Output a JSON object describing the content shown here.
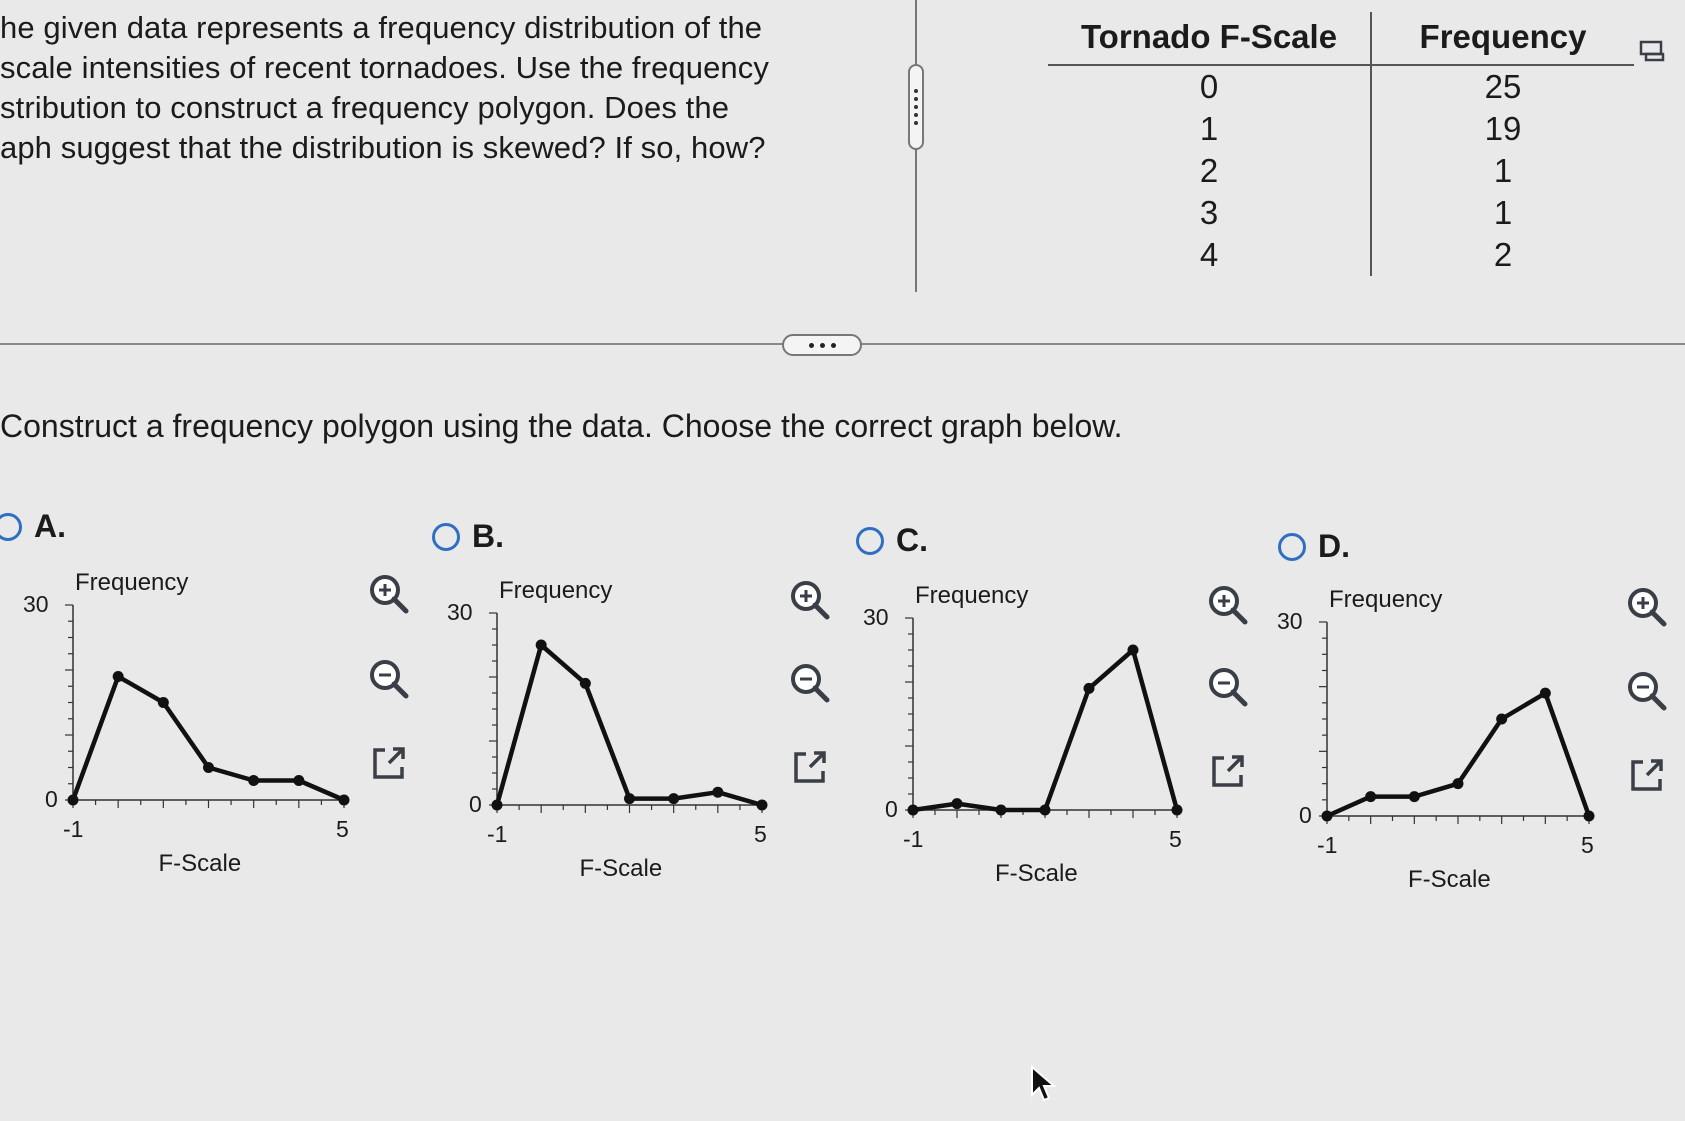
{
  "question": {
    "lines": [
      "he given data represents a frequency distribution of the",
      "scale intensities of recent tornadoes. Use the frequency",
      "stribution to construct a frequency polygon. Does the",
      "aph suggest that the distribution is skewed? If so, how?"
    ]
  },
  "table": {
    "col1_header": "Tornado F-Scale",
    "col2_header": "Frequency",
    "rows": [
      {
        "scale": "0",
        "frequency": "25"
      },
      {
        "scale": "1",
        "frequency": "19"
      },
      {
        "scale": "2",
        "frequency": "1"
      },
      {
        "scale": "3",
        "frequency": "1"
      },
      {
        "scale": "4",
        "frequency": "2"
      }
    ],
    "icon": "copy-table-icon"
  },
  "instruction": "Construct a frequency polygon using the data. Choose the correct graph below.",
  "options": [
    {
      "letter": "A.",
      "ylabel": "Frequency",
      "xlabel": "F-Scale",
      "y_top_tick": "30",
      "y_bottom_tick": "0",
      "x_left_tick": "-1",
      "x_right_tick": "5"
    },
    {
      "letter": "B.",
      "ylabel": "Frequency",
      "xlabel": "F-Scale",
      "y_top_tick": "30",
      "y_bottom_tick": "0",
      "x_left_tick": "-1",
      "x_right_tick": "5"
    },
    {
      "letter": "C.",
      "ylabel": "Frequency",
      "xlabel": "F-Scale",
      "y_top_tick": "30",
      "y_bottom_tick": "0",
      "x_left_tick": "-1",
      "x_right_tick": "5"
    },
    {
      "letter": "D.",
      "ylabel": "Frequency",
      "xlabel": "F-Scale",
      "y_top_tick": "30",
      "y_bottom_tick": "0",
      "x_left_tick": "-1",
      "x_right_tick": "5"
    }
  ],
  "chart_data": [
    {
      "type": "line",
      "title": "",
      "xlabel": "F-Scale",
      "ylabel": "Frequency",
      "x": [
        -1,
        0,
        1,
        2,
        3,
        4,
        5
      ],
      "values": [
        0,
        19,
        15,
        5,
        3,
        3,
        0
      ],
      "xlim": [
        -1,
        5
      ],
      "ylim": [
        0,
        30
      ]
    },
    {
      "type": "line",
      "title": "",
      "xlabel": "F-Scale",
      "ylabel": "Frequency",
      "x": [
        -1,
        0,
        1,
        2,
        3,
        4,
        5
      ],
      "values": [
        0,
        25,
        19,
        1,
        1,
        2,
        0
      ],
      "xlim": [
        -1,
        5
      ],
      "ylim": [
        0,
        30
      ]
    },
    {
      "type": "line",
      "title": "",
      "xlabel": "F-Scale",
      "ylabel": "Frequency",
      "x": [
        -1,
        0,
        1,
        2,
        3,
        4,
        5
      ],
      "values": [
        0,
        1,
        0,
        0,
        19,
        25,
        0
      ],
      "xlim": [
        -1,
        5
      ],
      "ylim": [
        0,
        30
      ]
    },
    {
      "type": "line",
      "title": "",
      "xlabel": "F-Scale",
      "ylabel": "Frequency",
      "x": [
        -1,
        0,
        1,
        2,
        3,
        4,
        5
      ],
      "values": [
        0,
        3,
        3,
        5,
        15,
        19,
        0
      ],
      "xlim": [
        -1,
        5
      ],
      "ylim": [
        0,
        30
      ]
    }
  ],
  "colors": {
    "radio": "#2f6fc2",
    "line": "#111111",
    "icon": "#3a3f47"
  },
  "tools": [
    "zoom-in-icon",
    "zoom-out-icon",
    "open-external-icon"
  ]
}
